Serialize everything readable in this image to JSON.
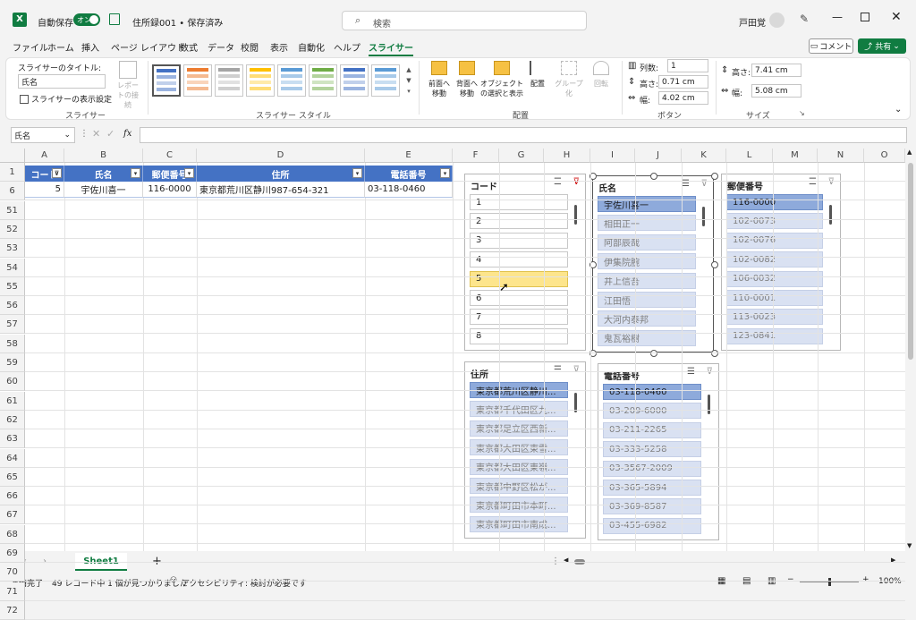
{
  "titlebar": {
    "autosave_label": "自動保存",
    "autosave_state": "オン",
    "doc_title": "住所録001 • 保存済み",
    "search_placeholder": "検索",
    "user_name": "戸田覚"
  },
  "menu": [
    "ファイル",
    "ホーム",
    "挿入",
    "ページ レイアウト",
    "数式",
    "データ",
    "校閲",
    "表示",
    "自動化",
    "ヘルプ",
    "スライサー"
  ],
  "menu_active": "スライサー",
  "header_buttons": {
    "comment": "コメント",
    "share": "共有"
  },
  "ribbon": {
    "slicer_caption_label": "スライサーのタイトル:",
    "slicer_caption_value": "氏名",
    "slicer_settings": "スライサーの表示設定",
    "report_connections": "レポートの接続",
    "group_slicer": "スライサー",
    "group_styles": "スライサー スタイル",
    "bring_forward": "前面へ移動",
    "send_backward": "背面へ移動",
    "selection_pane": "オブジェクトの選択と表示",
    "align": "配置",
    "group": "グループ化",
    "rotate": "回転",
    "group_arrange": "配置",
    "columns_label": "列数:",
    "columns_value": "1",
    "btn_height_label": "高さ:",
    "btn_height_value": "0.71 cm",
    "btn_width_label": "幅:",
    "btn_width_value": "4.02 cm",
    "group_buttons": "ボタン",
    "size_height_label": "高さ:",
    "size_height_value": "7.41 cm",
    "size_width_label": "幅:",
    "size_width_value": "5.08 cm",
    "group_size": "サイズ",
    "style_colors": [
      "#4472c4",
      "#ed7d31",
      "#a5a5a5",
      "#ffc000",
      "#5b9bd5",
      "#70ad47",
      "#4472c4",
      "#5b9bd5"
    ]
  },
  "formula_bar": {
    "name_box": "氏名",
    "fx": "fx",
    "formula": ""
  },
  "columns": [
    "A",
    "B",
    "C",
    "D",
    "E",
    "F",
    "G",
    "H",
    "I",
    "J",
    "K",
    "L",
    "M",
    "N",
    "O"
  ],
  "rows": [
    "1",
    "6",
    "51",
    "52",
    "53",
    "54",
    "55",
    "56",
    "57",
    "58",
    "59",
    "60",
    "61",
    "62",
    "63",
    "64",
    "65",
    "66",
    "67",
    "68",
    "69",
    "70",
    "71",
    "72"
  ],
  "table": {
    "headers": [
      "コード",
      "氏名",
      "郵便番号",
      "住所",
      "電話番号"
    ],
    "row": [
      "5",
      "宇佐川喜一",
      "116-0000",
      "東京都荒川区静川987-654-321",
      "03-118-0460"
    ]
  },
  "slicers": {
    "code": {
      "title": "コード",
      "items": [
        "1",
        "2",
        "3",
        "4",
        "5",
        "6",
        "7",
        "8"
      ],
      "hover_index": 4
    },
    "name": {
      "title": "氏名",
      "items": [
        "宇佐川喜一",
        "相田正一",
        "阿部辰哉",
        "伊集院腕",
        "井上信吾",
        "江田悟",
        "大河内泰邦",
        "鬼瓦裕樹"
      ]
    },
    "postal": {
      "title": "郵便番号",
      "items": [
        "116-0000",
        "102-0073",
        "102-0076",
        "102-0082",
        "106-0032",
        "110-0001",
        "113-0023",
        "123-0841"
      ]
    },
    "address": {
      "title": "住所",
      "items": [
        "東京都荒川区静川...",
        "東京都千代田区九...",
        "東京都足立区西新...",
        "東京都大田区東雪...",
        "東京都大田区東嶺...",
        "東京都中野区松が...",
        "東京都町田市本町...",
        "東京都町田市南成..."
      ]
    },
    "phone": {
      "title": "電話番号",
      "items": [
        "03-118-0460",
        "03-209-6000",
        "03-211-2265",
        "03-333-5258",
        "03-3567-2009",
        "03-365-5894",
        "03-369-8587",
        "03-455-6982"
      ]
    }
  },
  "sheet_tab": "Sheet1",
  "status": {
    "ready": "準備完了",
    "records": "49 レコード中 1 個が見つかりました",
    "accessibility": "アクセシビリティ: 検討が必要です",
    "zoom": "100%"
  }
}
